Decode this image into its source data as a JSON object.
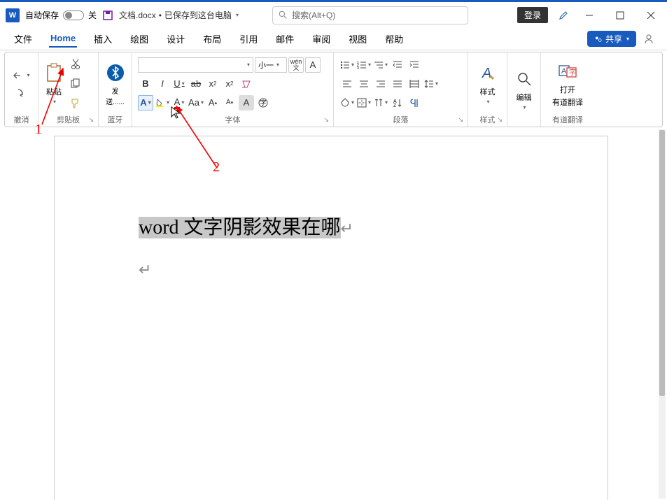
{
  "titlebar": {
    "autosave_label": "自动保存",
    "autosave_state": "关",
    "doc_name": "文档.docx",
    "saved_to": "已保存到这台电脑",
    "search_placeholder": "搜索(Alt+Q)",
    "login": "登录"
  },
  "tabs": {
    "file": "文件",
    "home": "Home",
    "insert": "插入",
    "draw": "绘图",
    "design": "设计",
    "layout": "布局",
    "references": "引用",
    "mailings": "邮件",
    "review": "审阅",
    "view": "视图",
    "help": "帮助",
    "share": "共享"
  },
  "ribbon": {
    "undo": "撤消",
    "clipboard": {
      "paste": "粘贴",
      "label": "剪贴板"
    },
    "bluetooth": {
      "send": "发送......",
      "label": "蓝牙"
    },
    "font": {
      "size": "小一",
      "wen": "wén",
      "label": "字体"
    },
    "paragraph": {
      "label": "段落"
    },
    "styles": {
      "btn": "样式",
      "label": "样式"
    },
    "editing": {
      "btn": "编辑"
    },
    "youdao": {
      "open": "打开",
      "translate": "有道翻译",
      "label": "有道翻译"
    }
  },
  "document": {
    "selected_text": "word 文字阴影效果在哪"
  },
  "annotations": {
    "one": "1",
    "two": "2"
  }
}
